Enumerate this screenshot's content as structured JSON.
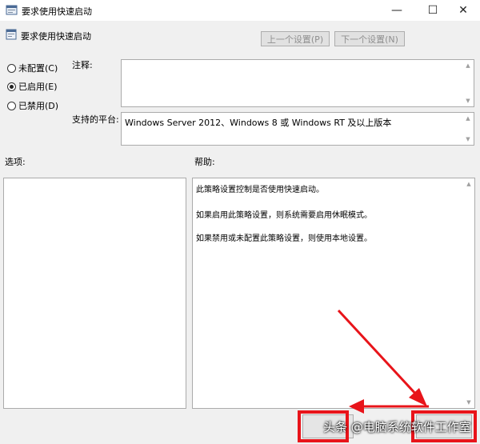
{
  "window": {
    "title": "要求使用快速启动",
    "minimize_glyph": "—",
    "maximize_glyph": "☐",
    "close_glyph": "✕"
  },
  "header": {
    "title": "要求使用快速启动",
    "prev_button": "上一个设置(P)",
    "next_button": "下一个设置(N)"
  },
  "state_options": [
    {
      "label": "未配置(C)",
      "checked": false
    },
    {
      "label": "已启用(E)",
      "checked": true
    },
    {
      "label": "已禁用(D)",
      "checked": false
    }
  ],
  "comment": {
    "label": "注释:",
    "value": ""
  },
  "platform": {
    "label": "支持的平台:",
    "value": "Windows Server 2012、Windows 8 或 Windows RT 及以上版本"
  },
  "options": {
    "label": "选项:"
  },
  "help": {
    "label": "帮助:",
    "lines": [
      "此策略设置控制是否使用快速启动。",
      "如果启用此策略设置，则系统需要启用休眠模式。",
      "如果禁用或未配置此策略设置，则使用本地设置。"
    ]
  },
  "watermark": {
    "text": "头条 @电脑系统软件工作室"
  },
  "colors": {
    "highlight": "#e8141a",
    "arrow": "#e8141a"
  }
}
